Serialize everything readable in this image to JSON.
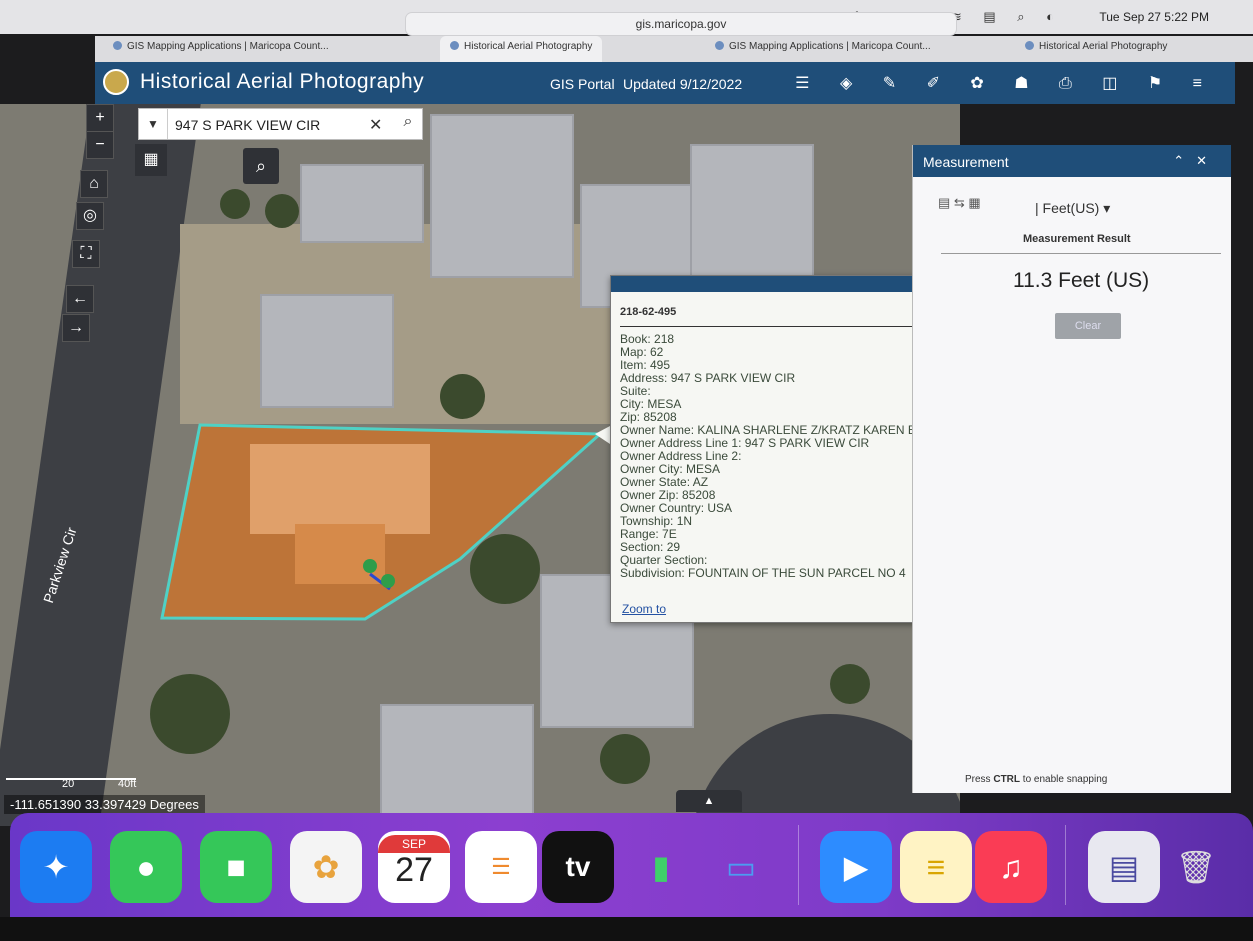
{
  "browser": {
    "url": "gis.maricopa.gov",
    "clock": "Tue Sep 27  5:22 PM",
    "tabs": [
      {
        "label": "GIS Mapping Applications | Maricopa Count..."
      },
      {
        "label": "Historical Aerial Photography"
      },
      {
        "label": "GIS Mapping Applications | Maricopa Count..."
      },
      {
        "label": "Historical Aerial Photography"
      }
    ]
  },
  "header": {
    "title": "Historical Aerial Photography",
    "portal_link": "GIS Portal",
    "updated": "Updated 9/12/2022"
  },
  "map": {
    "search_value": "947 S PARK VIEW CIR",
    "street_label": "Parkview Cir",
    "scale_labels": [
      "20",
      "40ft"
    ],
    "coordinates": "-111.651390 33.397429 Degrees"
  },
  "popup": {
    "parcel_id": "218-62-495",
    "fields": [
      "Book: 218",
      "Map: 62",
      "Item: 495",
      "Address: 947 S PARK VIEW CIR",
      "Suite:",
      "City: MESA",
      "Zip: 85208",
      "Owner Name: KALINA SHARLENE Z/KRATZ KAREN E",
      "Owner Address Line 1: 947 S PARK VIEW CIR",
      "Owner Address Line 2:",
      "Owner City: MESA",
      "Owner State: AZ",
      "Owner Zip: 85208",
      "Owner Country: USA",
      "Township: 1N",
      "Range: 7E",
      "Section: 29",
      "Quarter Section:",
      "Subdivision: FOUNTAIN OF THE SUN PARCEL NO 4"
    ],
    "zoom_link": "Zoom to",
    "more": "•••"
  },
  "measurement": {
    "title": "Measurement",
    "unit": "| Feet(US) ▾",
    "result_label": "Measurement Result",
    "result": "11.3 Feet (US)",
    "clear_button": "Clear",
    "hint_prefix": "Press ",
    "hint_key": "CTRL",
    "hint_suffix": " to enable snapping"
  },
  "dock": {
    "calendar_month": "SEP",
    "calendar_day": "27",
    "tv_label": "tv",
    "apps": [
      "safari-icon",
      "messages-icon",
      "facetime-icon",
      "photos-icon",
      "calendar-icon",
      "reminders-icon",
      "appletv-icon",
      "numbers-icon",
      "keynote-icon",
      "zoom-icon",
      "notes-icon",
      "music-icon",
      "document-icon",
      "trash-icon"
    ]
  },
  "colors": {
    "header_blue": "#1f4e79",
    "parcel_fill": "#c8732e",
    "parcel_outline": "#4fd1c5",
    "dock_purple": "#7e3bc8"
  }
}
